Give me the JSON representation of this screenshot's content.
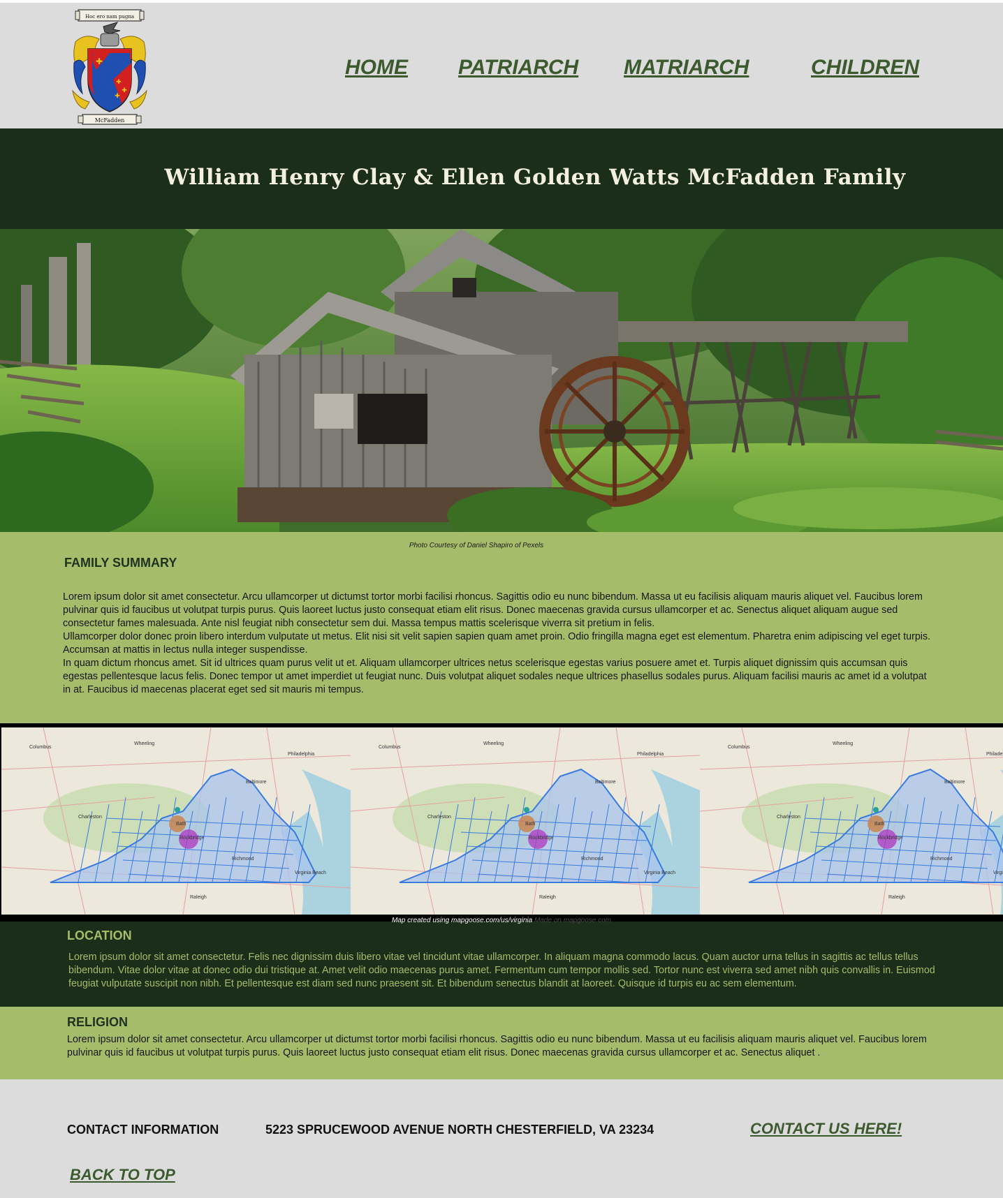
{
  "header": {
    "crest": {
      "motto": "Hoc ero nam pugna",
      "surname": "McFadden"
    },
    "nav": [
      "HOME",
      "PATRIARCH",
      "MATRIARCH",
      "CHILDREN"
    ]
  },
  "title": "William Henry Clay  & Ellen Golden Watts McFadden Family",
  "hero": {
    "caption": "Photo Courtesy of Daniel Shapiro of Pexels"
  },
  "family_summary": {
    "heading": "FAMILY SUMMARY",
    "paragraphs": [
      "Lorem ipsum dolor sit amet consectetur. Arcu ullamcorper ut dictumst tortor morbi facilisi rhoncus. Sagittis odio eu nunc bibendum. Massa ut eu facilisis aliquam mauris aliquet vel. Faucibus lorem pulvinar quis id faucibus ut volutpat turpis purus. Quis laoreet luctus justo consequat etiam elit risus. Donec maecenas gravida cursus ullamcorper et ac. Senectus aliquet aliquam augue sed consectetur fames malesuada. Ante nisl feugiat nibh consectetur sem dui. Massa tempus mattis scelerisque viverra sit pretium in felis.",
      "Ullamcorper dolor donec proin libero interdum vulputate ut metus. Elit nisi sit velit sapien sapien quam amet proin. Odio fringilla magna eget est elementum. Pharetra enim adipiscing vel eget turpis. Accumsan at mattis in lectus nulla integer suspendisse.",
      "In quam dictum rhoncus amet. Sit id ultrices quam purus velit ut et. Aliquam ullamcorper ultrices netus scelerisque egestas varius posuere amet et. Turpis aliquet dignissim quis accumsan quis egestas pellentesque lacus felis. Donec tempor ut amet imperdiet ut feugiat nunc. Duis volutpat aliquet sodales neque ultrices phasellus sodales purus. Aliquam facilisi mauris ac amet id a volutpat in at. Faucibus id maecenas placerat eget sed sit mauris mi tempus."
    ]
  },
  "maps": {
    "labels": [
      "Columbus",
      "Baltimore",
      "Philadelphia",
      "Bath",
      "Rockbridge",
      "Richmond",
      "Raleigh",
      "Virginia Beach",
      "Charleston",
      "Wheeling"
    ],
    "caption": "Map created using mapgoose.com/us/virginia",
    "caption_overlap": "Made on mapgoose.com"
  },
  "location": {
    "heading": "LOCATION",
    "text": "Lorem ipsum dolor sit amet consectetur. Felis nec dignissim duis libero vitae vel tincidunt vitae ullamcorper. In aliquam magna commodo lacus. Quam auctor urna tellus in sagittis ac tellus tellus bibendum. Vitae dolor vitae at donec odio dui tristique at. Amet velit odio maecenas purus amet. Fermentum cum tempor mollis sed. Tortor nunc est viverra sed amet nibh quis convallis in. Euismod feugiat vulputate suscipit non nibh. Et pellentesque est diam sed nunc praesent sit. Et bibendum senectus blandit at laoreet. Quisque id turpis eu ac sem elementum."
  },
  "religion": {
    "heading": "RELIGION",
    "text": "Lorem ipsum dolor sit amet consectetur. Arcu ullamcorper ut dictumst tortor morbi facilisi rhoncus. Sagittis odio eu nunc bibendum. Massa ut eu facilisis aliquam mauris aliquet vel. Faucibus lorem pulvinar quis id faucibus ut volutpat turpis purus. Quis laoreet luctus justo consequat etiam elit risus. Donec maecenas gravida cursus ullamcorper et ac. Senectus aliquet ."
  },
  "footer": {
    "contact_label": "CONTACT INFORMATION",
    "address": "5223 SPRUCEWOOD AVENUE NORTH CHESTERFIELD, VA 23234",
    "contact_link": "CONTACT US HERE!",
    "back_to_top": "BACK TO TOP"
  },
  "colors": {
    "header_bg": "#dcdcdc",
    "dark_green": "#1b2e1a",
    "light_green": "#a5bc6a",
    "link_green": "#3c5a2e",
    "title_text": "#f4f0e0"
  }
}
